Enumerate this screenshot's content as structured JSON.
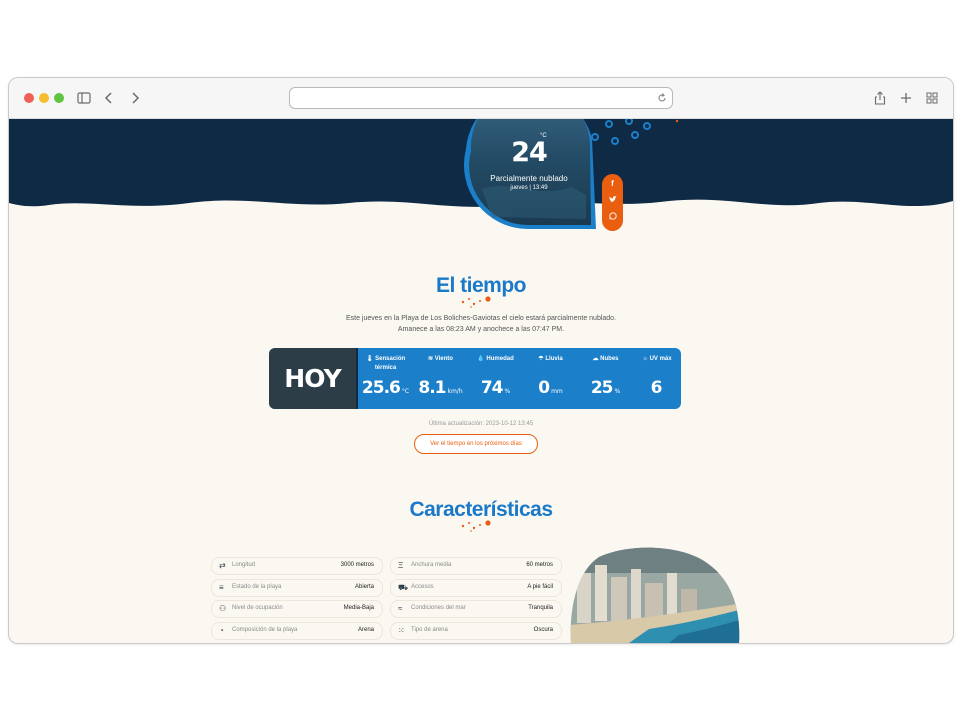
{
  "colors": {
    "navy": "#0f2a45",
    "blue": "#1b7fca",
    "orange": "#ea5e10",
    "dark": "#2c3d48",
    "cream": "#fbf8f2"
  },
  "browser": {
    "icons": [
      "close-dot",
      "minimize-dot",
      "zoom-dot",
      "sidebar-icon",
      "back-icon",
      "forward-icon",
      "reload-icon",
      "share-icon",
      "new-tab-icon",
      "tabs-overview-icon"
    ]
  },
  "hero": {
    "temperature": "24",
    "unit": "°C",
    "condition": "Parcialmente nublado",
    "date": "jueves | 13:49",
    "share_icons": [
      "facebook-icon",
      "twitter-icon",
      "whatsapp-icon"
    ]
  },
  "weather_section": {
    "title": "El tiempo",
    "description_line1": "Este jueves en la Playa de Los Boliches-Gaviotas el cielo estará parcialmente nublado.",
    "description_line2": "Amanece a las 08:23 AM y anochece a las 07:47 PM.",
    "today_label": "HOY",
    "metrics": [
      {
        "icon": "thermometer-icon",
        "label": "Sensación térmica",
        "value": "25.6",
        "unit": "°C"
      },
      {
        "icon": "wind-icon",
        "label": "Viento",
        "value": "8.1",
        "unit": "km/h"
      },
      {
        "icon": "humidity-icon",
        "label": "Humedad",
        "value": "74",
        "unit": "%"
      },
      {
        "icon": "rain-icon",
        "label": "Lluvia",
        "value": "0",
        "unit": "mm"
      },
      {
        "icon": "cloud-icon",
        "label": "Nubes",
        "value": "25",
        "unit": "%"
      },
      {
        "icon": "sun-icon",
        "label": "UV máx",
        "value": "6",
        "unit": ""
      }
    ],
    "updated": "Última actualización: 2023-10-12 13:45",
    "cta": "Ver el tiempo en los próximos días"
  },
  "features_section": {
    "title": "Características",
    "left": [
      {
        "icon": "length-icon",
        "label": "Longitud",
        "value": "3000 metros"
      },
      {
        "icon": "status-icon",
        "label": "Estado de la playa",
        "value": "Abierta"
      },
      {
        "icon": "occupancy-icon",
        "label": "Nivel de ocupación",
        "value": "Media-Baja"
      },
      {
        "icon": "composition-icon",
        "label": "Composición de la playa",
        "value": "Arena"
      }
    ],
    "right": [
      {
        "icon": "width-icon",
        "label": "Anchura media",
        "value": "60 metros"
      },
      {
        "icon": "access-icon",
        "label": "Accesos",
        "value": "A pie fácil"
      },
      {
        "icon": "sea-icon",
        "label": "Condiciones del mar",
        "value": "Tranquila"
      },
      {
        "icon": "sand-icon",
        "label": "Tipo de arena",
        "value": "Oscura"
      }
    ]
  }
}
